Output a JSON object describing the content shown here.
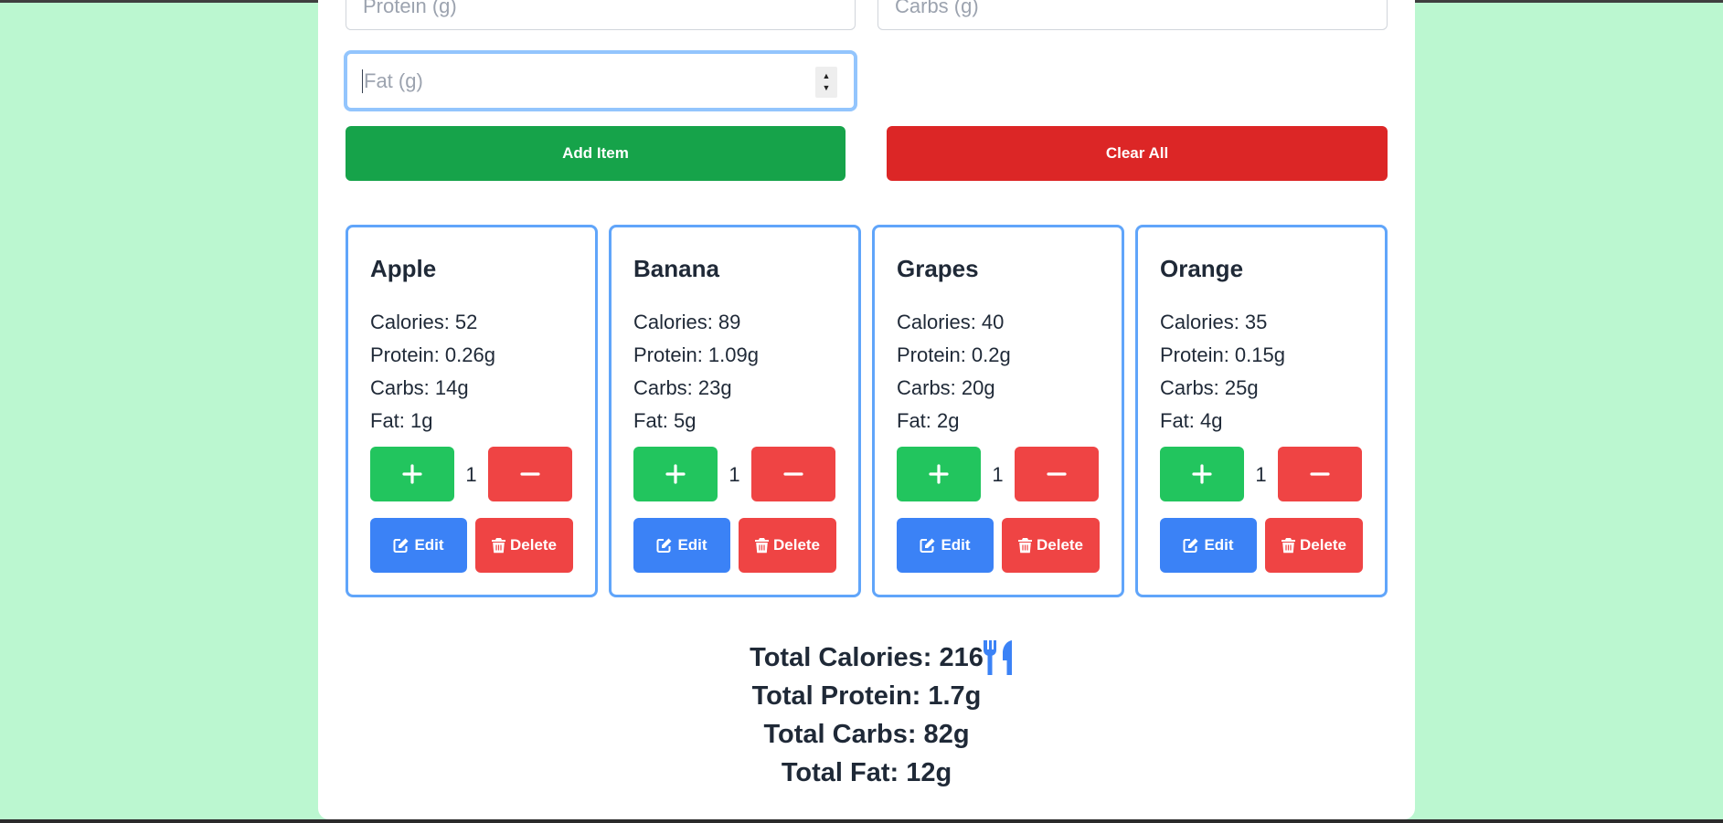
{
  "form": {
    "protein_placeholder": "Protein (g)",
    "carbs_placeholder": "Carbs (g)",
    "fat_placeholder": "Fat (g)",
    "add_label": "Add Item",
    "clear_label": "Clear All"
  },
  "items": [
    {
      "name": "Apple",
      "calories": "Calories: 52",
      "protein": "Protein: 0.26g",
      "carbs": "Carbs: 14g",
      "fat": "Fat: 1g",
      "qty": "1"
    },
    {
      "name": "Banana",
      "calories": "Calories: 89",
      "protein": "Protein: 1.09g",
      "carbs": "Carbs: 23g",
      "fat": "Fat: 5g",
      "qty": "1"
    },
    {
      "name": "Grapes",
      "calories": "Calories: 40",
      "protein": "Protein: 0.2g",
      "carbs": "Carbs: 20g",
      "fat": "Fat: 2g",
      "qty": "1"
    },
    {
      "name": "Orange",
      "calories": "Calories: 35",
      "protein": "Protein: 0.15g",
      "carbs": "Carbs: 25g",
      "fat": "Fat: 4g",
      "qty": "1"
    }
  ],
  "actions": {
    "edit_label": "Edit",
    "delete_label": "Delete"
  },
  "totals": {
    "calories": "Total Calories: 216",
    "protein": "Total Protein: 1.7g",
    "carbs": "Total Carbs: 82g",
    "fat": "Total Fat: 12g"
  },
  "icons": {
    "totals_icon": "utensils-icon",
    "edit_icon": "pen-square-icon",
    "delete_icon": "trash-icon",
    "plus_icon": "plus-icon",
    "minus_icon": "minus-icon"
  },
  "colors": {
    "background": "#bbf7d0",
    "add": "#16a34a",
    "clear": "#dc2626",
    "increment": "#22c55e",
    "decrement": "#ef4444",
    "edit": "#3b82f6",
    "card_border": "#60a5fa",
    "utensils": "#3b82f6"
  }
}
